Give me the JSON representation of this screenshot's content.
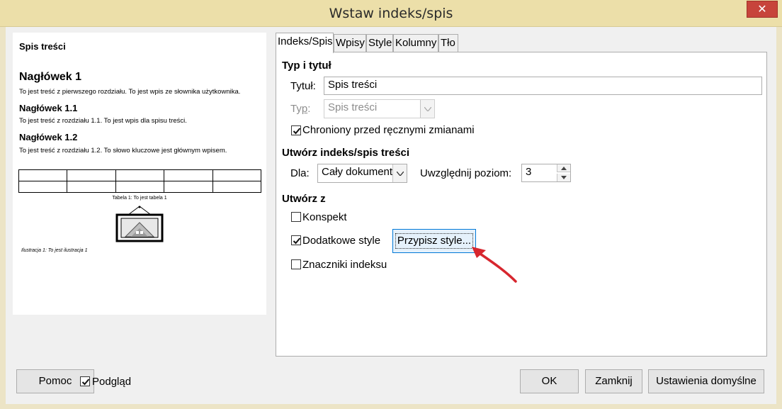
{
  "window": {
    "title": "Wstaw indeks/spis",
    "close_glyph": "✕"
  },
  "preview": {
    "title": "Spis treści",
    "heading1": "Nagłówek 1",
    "text1": "To jest treść z pierwszego rozdziału. To jest wpis ze słownika użytkownika.",
    "heading11": "Nagłówek 1.1",
    "text11": "To jest treść z rozdziału 1.1. To jest wpis dla spisu treści.",
    "heading12": "Nagłówek 1.2",
    "text12": "To jest treść z rozdziału 1.2. To słowo kluczowe jest głównym wpisem.",
    "table_caption": "Tabela 1: To jest tabela 1",
    "image_caption": "Ilustracja 1: To jest ilustracja 1"
  },
  "tabs": [
    {
      "label": "Indeks/Spis",
      "active": true
    },
    {
      "label": "Wpisy"
    },
    {
      "label": "Style"
    },
    {
      "label": "Kolumny"
    },
    {
      "label": "Tło"
    }
  ],
  "type_title": {
    "section": "Typ i tytuł",
    "title_label": "Tytuł:",
    "title_value": "Spis treści",
    "type_label_pre": "Ty",
    "type_label_u": "p",
    "type_label_post": ":",
    "type_value": "Spis treści",
    "protected_label": "Chroniony przed ręcznymi zmianami",
    "protected_checked": true
  },
  "create_index": {
    "section": "Utwórz indeks/spis treści",
    "for_label": "Dla:",
    "for_value": "Cały dokument",
    "level_label": "Uwzględnij poziom:",
    "level_value": "3"
  },
  "create_from": {
    "section": "Utwórz z",
    "outline_label": "Konspekt",
    "outline_checked": false,
    "styles_label": "Dodatkowe style",
    "styles_checked": true,
    "assign_styles_button": "Przypisz style...",
    "index_marks_label": "Znaczniki indeksu",
    "index_marks_checked": false
  },
  "footer": {
    "help_button": "Pomoc",
    "preview_label": "Podgląd",
    "preview_checked": true,
    "ok_button": "OK",
    "close_button": "Zamknij",
    "reset_button": "Ustawienia domyślne"
  },
  "colors": {
    "annotation_arrow": "#d7262e",
    "title_bar": "#ecdfa9",
    "close_button": "#c7443b"
  }
}
